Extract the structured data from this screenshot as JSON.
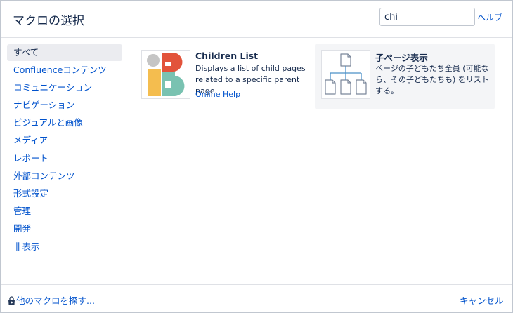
{
  "header": {
    "title": "マクロの選択",
    "search_value": "chi",
    "help_label": "ヘルプ"
  },
  "sidebar": {
    "items": [
      {
        "label": "すべて",
        "selected": true
      },
      {
        "label": "Confluenceコンテンツ"
      },
      {
        "label": "コミュニケーション"
      },
      {
        "label": "ナビゲーション"
      },
      {
        "label": "ビジュアルと画像"
      },
      {
        "label": "メディア"
      },
      {
        "label": "レポート"
      },
      {
        "label": "外部コンテンツ"
      },
      {
        "label": "形式設定"
      },
      {
        "label": "管理"
      },
      {
        "label": "開発"
      },
      {
        "label": "非表示"
      }
    ]
  },
  "macros": [
    {
      "name": "Children List",
      "description": "Displays a list of child pages related to a specific parent page.",
      "link": "Online Help",
      "icon": "children-list-logo-icon"
    },
    {
      "name": "子ページ表示",
      "description": "ページの子どもたち全員 (可能なら、その子どもたちも) をリストする。",
      "icon": "page-tree-icon"
    }
  ],
  "footer": {
    "find_more_label": "他のマクロを探す...",
    "find_more_icon": "marketplace-bag-icon",
    "cancel_label": "キャンセル"
  },
  "colors": {
    "link": "#0052cc",
    "text": "#172b4d",
    "selected_bg": "#ebecf0",
    "highlight_bg": "#f4f5f7",
    "logo_red": "#e2533b",
    "logo_teal": "#79c2b1",
    "logo_yellow": "#f4bd4f",
    "logo_gray": "#c5c5c5"
  }
}
